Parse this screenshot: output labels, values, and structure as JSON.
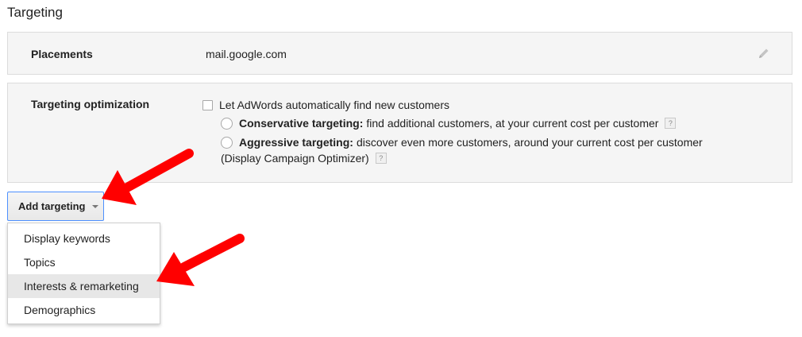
{
  "section": {
    "title": "Targeting"
  },
  "placements": {
    "label": "Placements",
    "value": "mail.google.com",
    "edit_icon": "pencil-icon"
  },
  "optimization": {
    "label": "Targeting optimization",
    "checkbox_label": "Let AdWords automatically find new customers",
    "checkbox_checked": false,
    "conservative": {
      "title": "Conservative targeting:",
      "description": "find additional customers, at your current cost per customer",
      "help": "?"
    },
    "aggressive": {
      "title": "Aggressive targeting:",
      "description": "discover even more customers, around your current cost per customer",
      "note": "(Display Campaign Optimizer)",
      "help": "?"
    }
  },
  "add_targeting": {
    "label": "Add targeting",
    "menu_items": [
      {
        "label": "Display keywords"
      },
      {
        "label": "Topics"
      },
      {
        "label": "Interests & remarketing",
        "highlighted": true
      },
      {
        "label": "Demographics"
      }
    ]
  },
  "colors": {
    "annotation_arrow": "#ff0000",
    "button_border": "#4d90fe",
    "panel_background": "#f5f5f5",
    "menu_highlight": "#e7e7e7"
  }
}
